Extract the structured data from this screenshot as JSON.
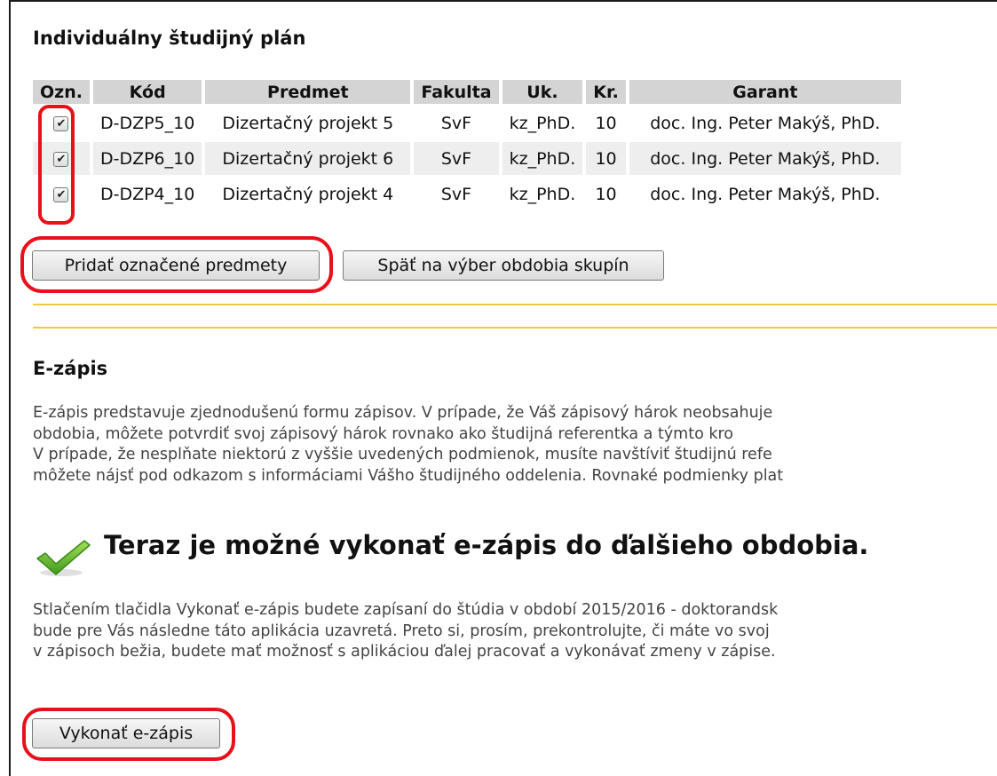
{
  "plan": {
    "title": "Individuálny študijný plán",
    "columns": [
      "Ozn.",
      "Kód",
      "Predmet",
      "Fakulta",
      "Uk.",
      "Kr.",
      "Garant"
    ],
    "rows": [
      {
        "checked": true,
        "code": "D-DZP5_10",
        "subject": "Dizertačný projekt 5",
        "faculty": "SvF",
        "completion": "kz_PhD.",
        "credits": "10",
        "guarantor": "doc. Ing. Peter Makýš, PhD."
      },
      {
        "checked": true,
        "code": "D-DZP6_10",
        "subject": "Dizertačný projekt 6",
        "faculty": "SvF",
        "completion": "kz_PhD.",
        "credits": "10",
        "guarantor": "doc. Ing. Peter Makýš, PhD."
      },
      {
        "checked": true,
        "code": "D-DZP4_10",
        "subject": "Dizertačný projekt 4",
        "faculty": "SvF",
        "completion": "kz_PhD.",
        "credits": "10",
        "guarantor": "doc. Ing. Peter Makýš, PhD."
      }
    ],
    "add_button": "Pridať označené predmety",
    "back_button": "Späť na výber obdobia skupín"
  },
  "ezapis": {
    "title": "E-zápis",
    "intro_lines": [
      "E-zápis predstavuje zjednodušenú formu zápisov. V prípade, že Váš zápisový hárok neobsahuje",
      "obdobia, môžete potvrdiť svoj zápisový hárok rovnako ako študijná referentka a týmto kro",
      "V prípade, že nesplňate niektorú z vyššie uvedených podmienok, musíte navštíviť študijnú refe",
      "môžete nájsť pod odkazom s informáciami Vášho študijného oddelenia. Rovnaké podmienky plat"
    ],
    "status_message": "Teraz je možné vykonať e-zápis do ďalšieho obdobia.",
    "detail_lines": [
      "Stlačením tlačidla Vykonať e-zápis budete zapísaní do štúdia v období 2015/2016 - doktorandsk",
      "bude pre Vás následne táto aplikácia uzavretá. Preto si, prosím, prekontrolujte, či máte vo svoj",
      "v zápisoch bežia, budete mať možnosť s aplikáciou ďalej pracovať a vykonávať zmeny v zápise."
    ],
    "submit_button": "Vykonať e-zápis"
  },
  "colors": {
    "link": "#d98c3e",
    "divider": "#f4c542",
    "highlight": "#e8101a",
    "header_bg": "#d4d4d4",
    "row_alt": "#eeeeee"
  },
  "icons": {
    "status": "checkmark-icon",
    "checkbox_mark": "✔"
  }
}
